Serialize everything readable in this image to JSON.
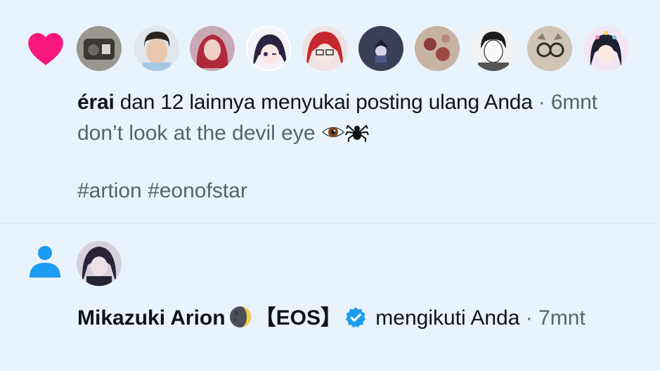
{
  "like_notification": {
    "icon": "heart-icon",
    "icon_color": "#f91880",
    "avatars": [
      {
        "name": "avatar-1"
      },
      {
        "name": "avatar-2"
      },
      {
        "name": "avatar-3"
      },
      {
        "name": "avatar-4"
      },
      {
        "name": "avatar-5"
      },
      {
        "name": "avatar-6"
      },
      {
        "name": "avatar-7"
      },
      {
        "name": "avatar-8"
      },
      {
        "name": "avatar-9"
      },
      {
        "name": "avatar-10"
      }
    ],
    "user": "érai",
    "action_text": " dan 12 lainnya menyukai posting ulang Anda",
    "separator": " · ",
    "time": "6mnt",
    "post_text": "don’t look at the devil eye ",
    "hashtags": "#artion #eonofstar"
  },
  "follow_notification": {
    "icon": "person-icon",
    "icon_color": "#1d9bf0",
    "user": "Mikazuki Arion",
    "user_suffix": "【EOS】",
    "action_text": " mengikuti Anda",
    "separator": " · ",
    "time": "7mnt",
    "verified_color": "#1d9bf0"
  }
}
